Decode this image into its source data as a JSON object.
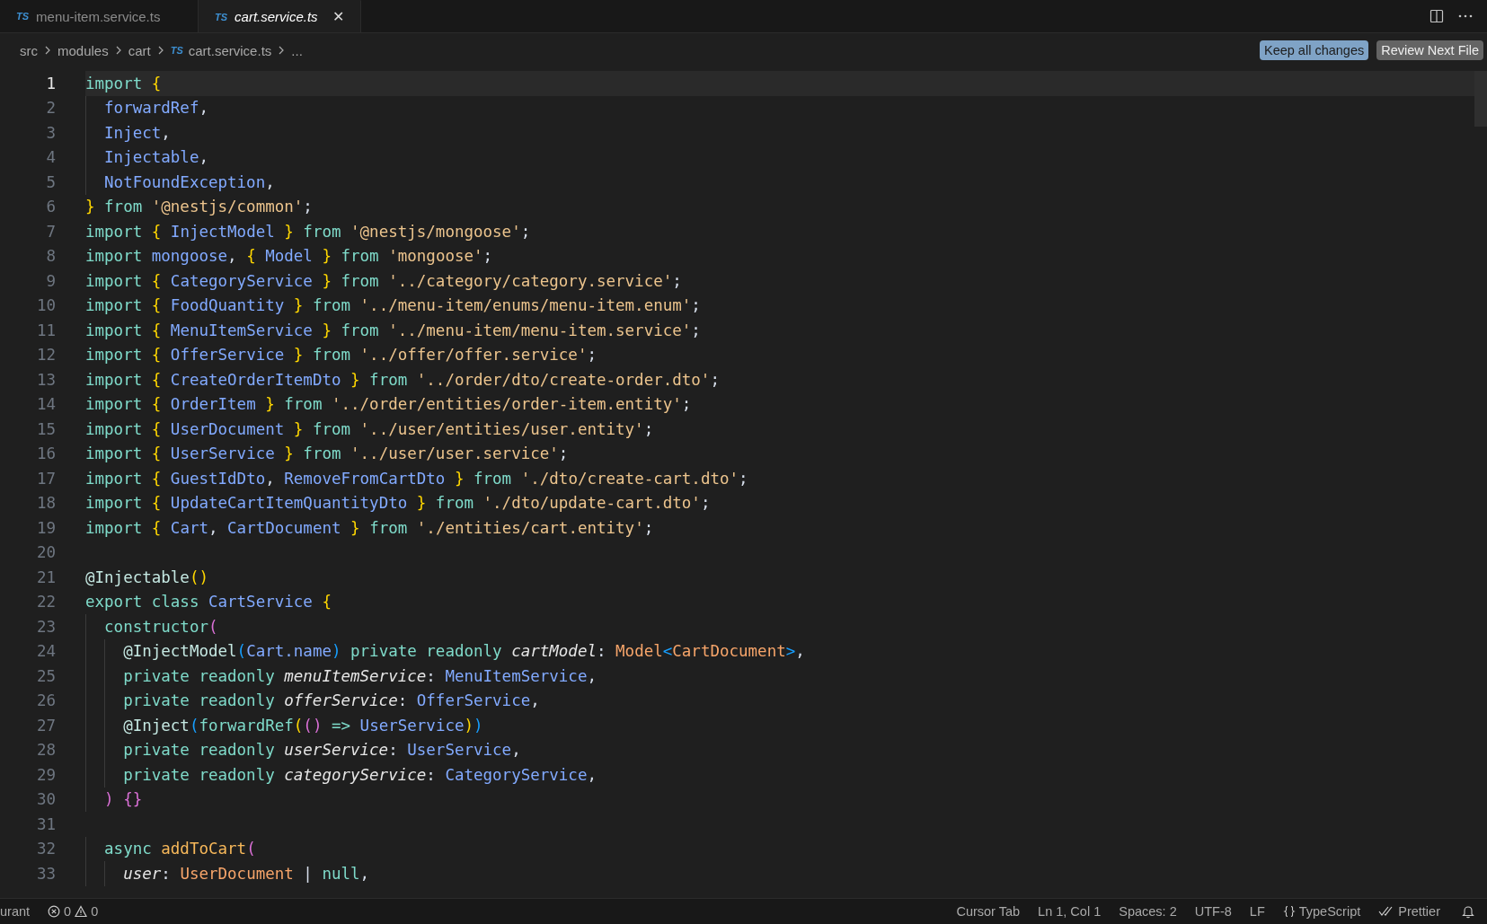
{
  "tabs": [
    {
      "lang": "TS",
      "label": "menu-item.service.ts",
      "selected": false
    },
    {
      "lang": "TS",
      "label": "cart.service.ts",
      "selected": true,
      "close": "✕"
    }
  ],
  "breadcrumb": [
    {
      "label": "src"
    },
    {
      "label": "modules"
    },
    {
      "label": "cart"
    },
    {
      "label": "cart.service.ts",
      "lang": "TS"
    },
    {
      "label": "..."
    }
  ],
  "buttons": [
    {
      "label": "Keep all changes",
      "kind": "primary"
    },
    {
      "label": "Review Next File",
      "kind": "secondary"
    }
  ],
  "lines": [
    {
      "n": "1",
      "selected": true,
      "tokens": [
        {
          "text": "import ",
          "kind": "keyword"
        },
        {
          "text": "{",
          "kind": "brace"
        }
      ]
    },
    {
      "n": "2",
      "selected": false,
      "tokens": [
        {
          "text": "  forwardRef",
          "kind": "name"
        },
        {
          "text": ",",
          "kind": "plain"
        }
      ]
    },
    {
      "n": "3",
      "selected": false,
      "tokens": [
        {
          "text": "  Inject",
          "kind": "name"
        },
        {
          "text": ",",
          "kind": "plain"
        }
      ]
    },
    {
      "n": "4",
      "selected": false,
      "tokens": [
        {
          "text": "  Injectable",
          "kind": "name"
        },
        {
          "text": ",",
          "kind": "plain"
        }
      ]
    },
    {
      "n": "5",
      "selected": false,
      "tokens": [
        {
          "text": "  NotFoundException",
          "kind": "name"
        },
        {
          "text": ",",
          "kind": "plain"
        }
      ]
    },
    {
      "n": "6",
      "selected": false,
      "tokens": [
        {
          "text": "} ",
          "kind": "brace"
        },
        {
          "text": "from ",
          "kind": "keyword"
        },
        {
          "text": "'@nestjs/common'",
          "kind": "string"
        },
        {
          "text": ";",
          "kind": "plain"
        }
      ]
    },
    {
      "n": "7",
      "selected": false,
      "tokens": [
        {
          "text": "import ",
          "kind": "keyword"
        },
        {
          "text": "{ ",
          "kind": "brace"
        },
        {
          "text": "InjectModel ",
          "kind": "name"
        },
        {
          "text": "} ",
          "kind": "brace"
        },
        {
          "text": "from ",
          "kind": "keyword"
        },
        {
          "text": "'@nestjs/mongoose'",
          "kind": "string"
        },
        {
          "text": ";",
          "kind": "plain"
        }
      ]
    },
    {
      "n": "8",
      "selected": false,
      "tokens": [
        {
          "text": "import ",
          "kind": "keyword"
        },
        {
          "text": "mongoose",
          "kind": "name"
        },
        {
          "text": ", ",
          "kind": "plain"
        },
        {
          "text": "{ ",
          "kind": "brace"
        },
        {
          "text": "Model ",
          "kind": "name"
        },
        {
          "text": "} ",
          "kind": "brace"
        },
        {
          "text": "from ",
          "kind": "keyword"
        },
        {
          "text": "'mongoose'",
          "kind": "string"
        },
        {
          "text": ";",
          "kind": "plain"
        }
      ]
    },
    {
      "n": "9",
      "selected": false,
      "tokens": [
        {
          "text": "import ",
          "kind": "keyword"
        },
        {
          "text": "{ ",
          "kind": "brace"
        },
        {
          "text": "CategoryService ",
          "kind": "name"
        },
        {
          "text": "} ",
          "kind": "brace"
        },
        {
          "text": "from ",
          "kind": "keyword"
        },
        {
          "text": "'../category/category.service'",
          "kind": "string"
        },
        {
          "text": ";",
          "kind": "plain"
        }
      ]
    },
    {
      "n": "10",
      "selected": false,
      "tokens": [
        {
          "text": "import ",
          "kind": "keyword"
        },
        {
          "text": "{ ",
          "kind": "brace"
        },
        {
          "text": "FoodQuantity ",
          "kind": "name"
        },
        {
          "text": "} ",
          "kind": "brace"
        },
        {
          "text": "from ",
          "kind": "keyword"
        },
        {
          "text": "'../menu-item/enums/menu-item.enum'",
          "kind": "string"
        },
        {
          "text": ";",
          "kind": "plain"
        }
      ]
    },
    {
      "n": "11",
      "selected": false,
      "tokens": [
        {
          "text": "import ",
          "kind": "keyword"
        },
        {
          "text": "{ ",
          "kind": "brace"
        },
        {
          "text": "MenuItemService ",
          "kind": "name"
        },
        {
          "text": "} ",
          "kind": "brace"
        },
        {
          "text": "from ",
          "kind": "keyword"
        },
        {
          "text": "'../menu-item/menu-item.service'",
          "kind": "string"
        },
        {
          "text": ";",
          "kind": "plain"
        }
      ]
    },
    {
      "n": "12",
      "selected": false,
      "tokens": [
        {
          "text": "import ",
          "kind": "keyword"
        },
        {
          "text": "{ ",
          "kind": "brace"
        },
        {
          "text": "OfferService ",
          "kind": "name"
        },
        {
          "text": "} ",
          "kind": "brace"
        },
        {
          "text": "from ",
          "kind": "keyword"
        },
        {
          "text": "'../offer/offer.service'",
          "kind": "string"
        },
        {
          "text": ";",
          "kind": "plain"
        }
      ]
    },
    {
      "n": "13",
      "selected": false,
      "tokens": [
        {
          "text": "import ",
          "kind": "keyword"
        },
        {
          "text": "{ ",
          "kind": "brace"
        },
        {
          "text": "CreateOrderItemDto ",
          "kind": "name"
        },
        {
          "text": "} ",
          "kind": "brace"
        },
        {
          "text": "from ",
          "kind": "keyword"
        },
        {
          "text": "'../order/dto/create-order.dto'",
          "kind": "string"
        },
        {
          "text": ";",
          "kind": "plain"
        }
      ]
    },
    {
      "n": "14",
      "selected": false,
      "tokens": [
        {
          "text": "import ",
          "kind": "keyword"
        },
        {
          "text": "{ ",
          "kind": "brace"
        },
        {
          "text": "OrderItem ",
          "kind": "name"
        },
        {
          "text": "} ",
          "kind": "brace"
        },
        {
          "text": "from ",
          "kind": "keyword"
        },
        {
          "text": "'../order/entities/order-item.entity'",
          "kind": "string"
        },
        {
          "text": ";",
          "kind": "plain"
        }
      ]
    },
    {
      "n": "15",
      "selected": false,
      "tokens": [
        {
          "text": "import ",
          "kind": "keyword"
        },
        {
          "text": "{ ",
          "kind": "brace"
        },
        {
          "text": "UserDocument ",
          "kind": "name"
        },
        {
          "text": "} ",
          "kind": "brace"
        },
        {
          "text": "from ",
          "kind": "keyword"
        },
        {
          "text": "'../user/entities/user.entity'",
          "kind": "string"
        },
        {
          "text": ";",
          "kind": "plain"
        }
      ]
    },
    {
      "n": "16",
      "selected": false,
      "tokens": [
        {
          "text": "import ",
          "kind": "keyword"
        },
        {
          "text": "{ ",
          "kind": "brace"
        },
        {
          "text": "UserService ",
          "kind": "name"
        },
        {
          "text": "} ",
          "kind": "brace"
        },
        {
          "text": "from ",
          "kind": "keyword"
        },
        {
          "text": "'../user/user.service'",
          "kind": "string"
        },
        {
          "text": ";",
          "kind": "plain"
        }
      ]
    },
    {
      "n": "17",
      "selected": false,
      "tokens": [
        {
          "text": "import ",
          "kind": "keyword"
        },
        {
          "text": "{ ",
          "kind": "brace"
        },
        {
          "text": "GuestIdDto",
          "kind": "name"
        },
        {
          "text": ", ",
          "kind": "plain"
        },
        {
          "text": "RemoveFromCartDto ",
          "kind": "name"
        },
        {
          "text": "} ",
          "kind": "brace"
        },
        {
          "text": "from ",
          "kind": "keyword"
        },
        {
          "text": "'./dto/create-cart.dto'",
          "kind": "string"
        },
        {
          "text": ";",
          "kind": "plain"
        }
      ]
    },
    {
      "n": "18",
      "selected": false,
      "tokens": [
        {
          "text": "import ",
          "kind": "keyword"
        },
        {
          "text": "{ ",
          "kind": "brace"
        },
        {
          "text": "UpdateCartItemQuantityDto ",
          "kind": "name"
        },
        {
          "text": "} ",
          "kind": "brace"
        },
        {
          "text": "from ",
          "kind": "keyword"
        },
        {
          "text": "'./dto/update-cart.dto'",
          "kind": "string"
        },
        {
          "text": ";",
          "kind": "plain"
        }
      ]
    },
    {
      "n": "19",
      "selected": false,
      "tokens": [
        {
          "text": "import ",
          "kind": "keyword"
        },
        {
          "text": "{ ",
          "kind": "brace"
        },
        {
          "text": "Cart",
          "kind": "name"
        },
        {
          "text": ", ",
          "kind": "plain"
        },
        {
          "text": "CartDocument ",
          "kind": "name"
        },
        {
          "text": "} ",
          "kind": "brace"
        },
        {
          "text": "from ",
          "kind": "keyword"
        },
        {
          "text": "'./entities/cart.entity'",
          "kind": "string"
        },
        {
          "text": ";",
          "kind": "plain"
        }
      ]
    },
    {
      "n": "20",
      "selected": false
    },
    {
      "n": "21",
      "selected": false,
      "tokens": [
        {
          "text": "@Injectable",
          "kind": "decorator"
        },
        {
          "text": "()",
          "kind": "brace"
        }
      ]
    },
    {
      "n": "22",
      "selected": false,
      "tokens": [
        {
          "text": "export class ",
          "kind": "keyword"
        },
        {
          "text": "CartService ",
          "kind": "name"
        },
        {
          "text": "{",
          "kind": "brace"
        }
      ]
    },
    {
      "n": "23",
      "selected": false,
      "tokens": [
        {
          "text": "  constructor",
          "kind": "keyword"
        },
        {
          "text": "(",
          "kind": "paren"
        }
      ]
    },
    {
      "n": "24",
      "selected": false,
      "tokens": [
        {
          "text": "    @InjectModel",
          "kind": "decorator"
        },
        {
          "text": "(",
          "kind": "bracket"
        },
        {
          "text": "Cart.name",
          "kind": "name"
        },
        {
          "text": ") ",
          "kind": "bracket"
        },
        {
          "text": "private readonly ",
          "kind": "keyword"
        },
        {
          "text": "cartModel",
          "kind": "param"
        },
        {
          "text": ": ",
          "kind": "plain"
        },
        {
          "text": "Model",
          "kind": "type"
        },
        {
          "text": "<",
          "kind": "bracket"
        },
        {
          "text": "CartDocument",
          "kind": "type"
        },
        {
          "text": ">",
          "kind": "bracket"
        },
        {
          "text": ",",
          "kind": "plain"
        }
      ]
    },
    {
      "n": "25",
      "selected": false,
      "tokens": [
        {
          "text": "    private readonly ",
          "kind": "keyword"
        },
        {
          "text": "menuItemService",
          "kind": "param"
        },
        {
          "text": ": ",
          "kind": "plain"
        },
        {
          "text": "MenuItemService",
          "kind": "name"
        },
        {
          "text": ",",
          "kind": "plain"
        }
      ]
    },
    {
      "n": "26",
      "selected": false,
      "tokens": [
        {
          "text": "    private readonly ",
          "kind": "keyword"
        },
        {
          "text": "offerService",
          "kind": "param"
        },
        {
          "text": ": ",
          "kind": "plain"
        },
        {
          "text": "OfferService",
          "kind": "name"
        },
        {
          "text": ",",
          "kind": "plain"
        }
      ]
    },
    {
      "n": "27",
      "selected": false,
      "tokens": [
        {
          "text": "    @Inject",
          "kind": "decorator"
        },
        {
          "text": "(",
          "kind": "bracket"
        },
        {
          "text": "forwardRef",
          "kind": "keyword"
        },
        {
          "text": "(",
          "kind": "brace"
        },
        {
          "text": "()",
          "kind": "paren"
        },
        {
          "text": " => ",
          "kind": "keyword"
        },
        {
          "text": "UserService",
          "kind": "name"
        },
        {
          "text": ")",
          "kind": "brace"
        },
        {
          "text": ")",
          "kind": "bracket"
        }
      ]
    },
    {
      "n": "28",
      "selected": false,
      "tokens": [
        {
          "text": "    private readonly ",
          "kind": "keyword"
        },
        {
          "text": "userService",
          "kind": "param"
        },
        {
          "text": ": ",
          "kind": "plain"
        },
        {
          "text": "UserService",
          "kind": "name"
        },
        {
          "text": ",",
          "kind": "plain"
        }
      ]
    },
    {
      "n": "29",
      "selected": false,
      "tokens": [
        {
          "text": "    private readonly ",
          "kind": "keyword"
        },
        {
          "text": "categoryService",
          "kind": "param"
        },
        {
          "text": ": ",
          "kind": "plain"
        },
        {
          "text": "CategoryService",
          "kind": "name"
        },
        {
          "text": ",",
          "kind": "plain"
        }
      ]
    },
    {
      "n": "30",
      "selected": false,
      "tokens": [
        {
          "text": "  ) {}",
          "kind": "paren"
        }
      ]
    },
    {
      "n": "31",
      "selected": false
    },
    {
      "n": "32",
      "selected": false,
      "tokens": [
        {
          "text": "  async ",
          "kind": "keyword"
        },
        {
          "text": "addToCart",
          "kind": "function"
        },
        {
          "text": "(",
          "kind": "paren"
        }
      ]
    },
    {
      "n": "33",
      "selected": false,
      "tokens": [
        {
          "text": "    user",
          "kind": "param"
        },
        {
          "text": ": ",
          "kind": "plain"
        },
        {
          "text": "UserDocument",
          "kind": "type"
        },
        {
          "text": " | ",
          "kind": "plain"
        },
        {
          "text": "null",
          "kind": "keyword"
        },
        {
          "text": ",",
          "kind": "plain"
        }
      ]
    }
  ],
  "status": {
    "left": "urant",
    "errors": "0",
    "warnings": "0",
    "items": [
      "Cursor Tab",
      "Ln 1, Col 1",
      "Spaces: 2",
      "UTF-8",
      "LF"
    ],
    "language": "TypeScript",
    "formatter": "Prettier"
  }
}
